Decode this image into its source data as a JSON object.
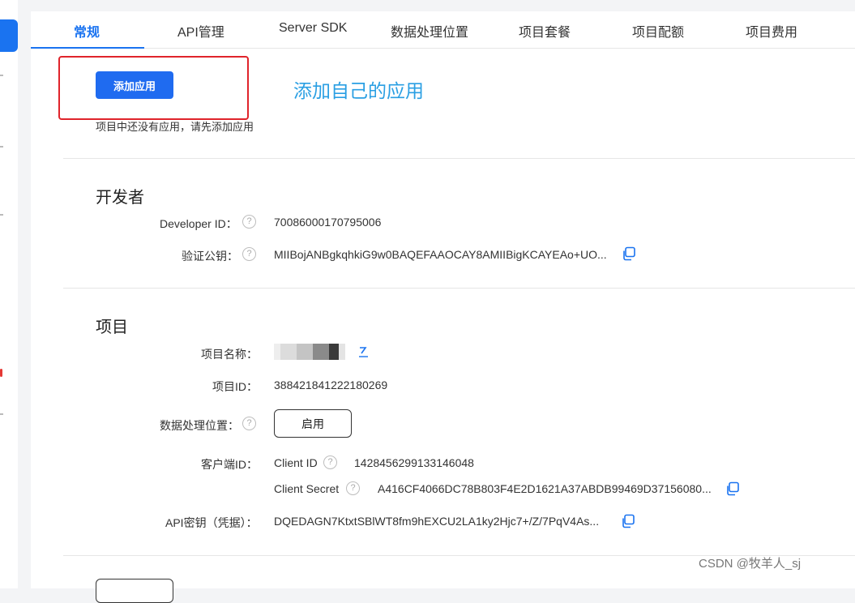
{
  "tabs": [
    {
      "label": "常规"
    },
    {
      "label": "API管理"
    },
    {
      "label": "Server SDK"
    },
    {
      "label": "数据处理位置"
    },
    {
      "label": "项目套餐"
    },
    {
      "label": "项目配额"
    },
    {
      "label": "项目费用"
    }
  ],
  "apps": {
    "add_button_label": "添加应用",
    "annotation": "添加自己的应用",
    "empty_hint": "项目中还没有应用，请先添加应用"
  },
  "developer": {
    "title": "开发者",
    "developer_id_label": "Developer ID：",
    "developer_id_value": "70086000170795006",
    "public_key_label": "验证公钥：",
    "public_key_value": "MIIBojANBgkqhkiG9w0BAQEFAAOCAY8AMIIBigKCAYEAo+UO..."
  },
  "project": {
    "title": "项目",
    "name_label": "项目名称：",
    "id_label": "项目ID：",
    "id_value": "388421841222180269",
    "location_label": "数据处理位置：",
    "enable_button_label": "启用",
    "client_label": "客户端ID：",
    "client_id_label": "Client ID",
    "client_id_value": "1428456299133146048",
    "client_secret_label": "Client Secret",
    "client_secret_value": "A416CF4066DC78B803F4E2D1621A37ABDB99469D37156080...",
    "api_key_label": "API密钥（凭据）：",
    "api_key_value": "DQEDAGN7KtxtSBlWT8fm9hEXCU2LA1ky2Hjc7+/Z/7PqV4As..."
  },
  "help_glyph": "?",
  "watermark": "CSDN @牧羊人_sj",
  "colors": {
    "accent": "#1a73f0",
    "annotation": "#2a9fe3",
    "highlight_box": "#e0242b"
  }
}
